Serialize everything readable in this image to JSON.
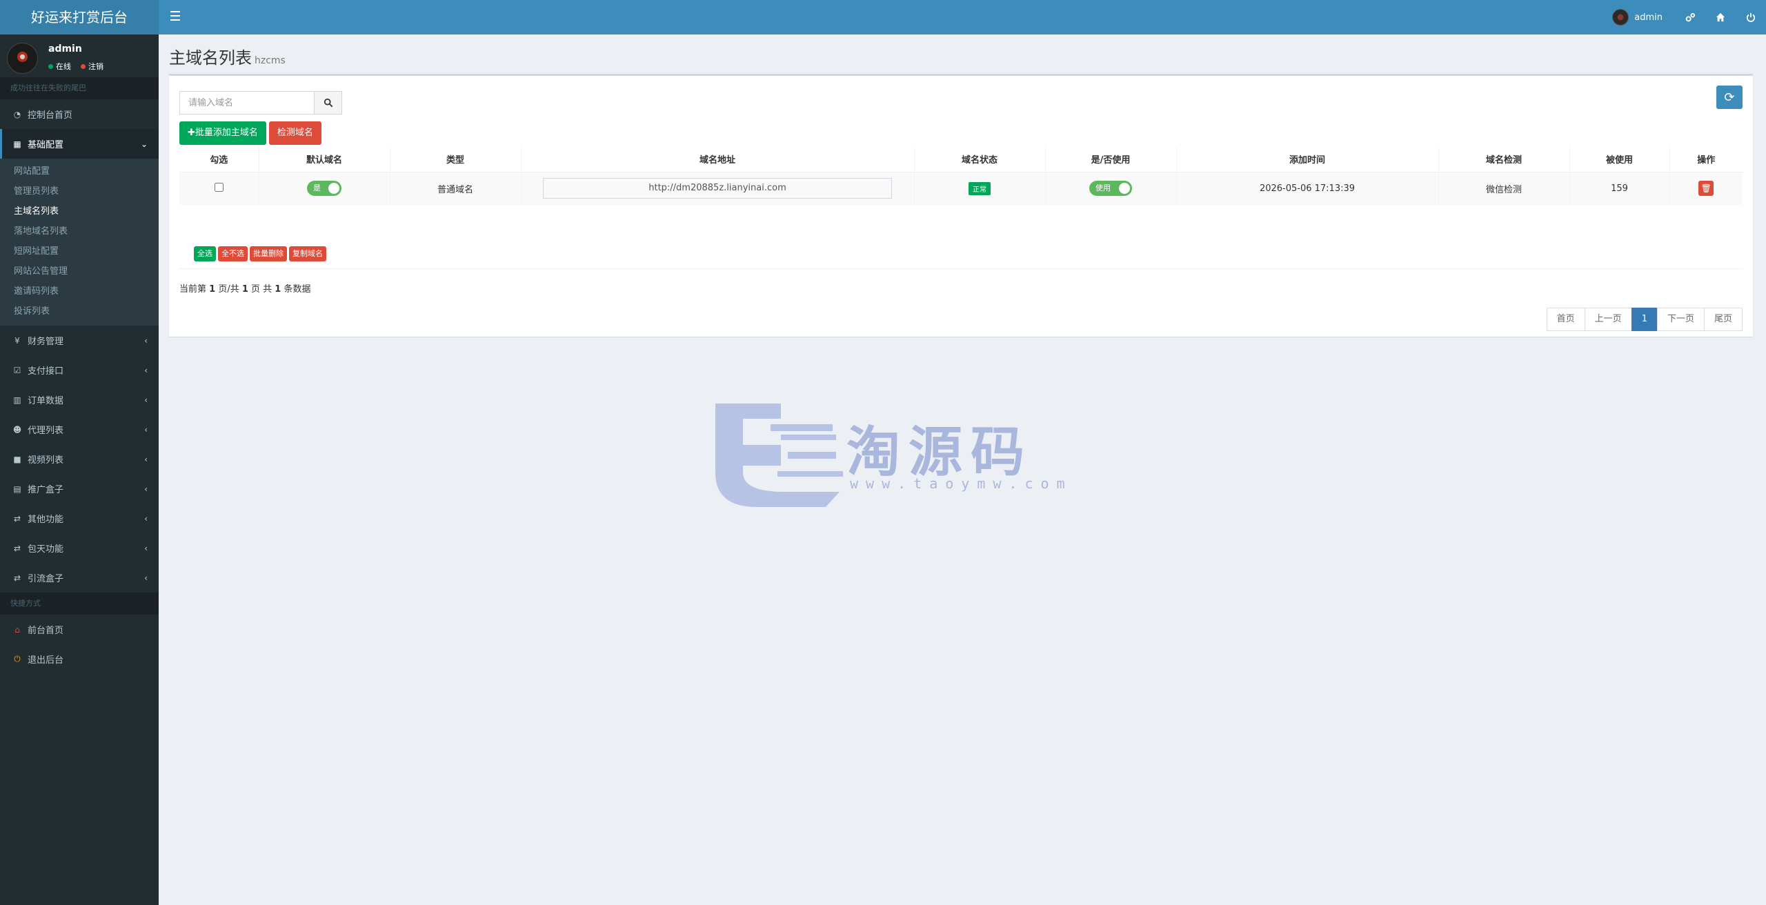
{
  "app": {
    "title": "好运来打赏后台"
  },
  "topbar": {
    "user_name": "admin"
  },
  "sidebar": {
    "user": {
      "name": "admin",
      "online": "在线",
      "logout": "注销"
    },
    "section1": "成功往往在失败的尾巴",
    "dashboard": "控制台首页",
    "basic_config": "基础配置",
    "submenu": [
      "网站配置",
      "管理员列表",
      "主域名列表",
      "落地域名列表",
      "短网址配置",
      "网站公告管理",
      "邀请码列表",
      "投诉列表"
    ],
    "menu": [
      "财务管理",
      "支付接口",
      "订单数据",
      "代理列表",
      "视频列表",
      "推广盒子",
      "其他功能",
      "包天功能",
      "引流盒子"
    ],
    "section2": "快捷方式",
    "front_home": "前台首页",
    "exit": "退出后台"
  },
  "page": {
    "title": "主域名列表",
    "subtitle": "hzcms"
  },
  "search": {
    "placeholder": "请输入域名"
  },
  "buttons": {
    "batch_add": "✚批量添加主域名",
    "check": "检测域名"
  },
  "table": {
    "headers": [
      "勾选",
      "默认域名",
      "类型",
      "域名地址",
      "域名状态",
      "是/否使用",
      "添加时间",
      "域名检测",
      "被使用",
      "操作"
    ],
    "rows": [
      {
        "default": "是",
        "type": "普通域名",
        "url": "http://dm20885z.lianyinai.com",
        "status": "正常",
        "use": "使用",
        "time": "2026-05-06 17:13:39",
        "check": "微信检测",
        "used": "159"
      }
    ]
  },
  "bulk": {
    "select_all": "全选",
    "select_none": "全不选",
    "batch_delete": "批量删除",
    "copy": "复制域名"
  },
  "pageinfo": {
    "p1": "当前第 ",
    "current": "1",
    "p2": " 页/共 ",
    "total": "1",
    "p3": " 页 共 ",
    "count": "1",
    "p4": " 条数据"
  },
  "pager": {
    "first": "首页",
    "prev": "上一页",
    "current": "1",
    "next": "下一页",
    "last": "尾页"
  },
  "watermark": {
    "text": "淘源码",
    "url": "www.taoymw.com"
  },
  "colors": {
    "header": "#3c8dbc",
    "logo": "#367fa9",
    "sidebar": "#222d32",
    "success": "#00a65a",
    "danger": "#dd4b39"
  }
}
